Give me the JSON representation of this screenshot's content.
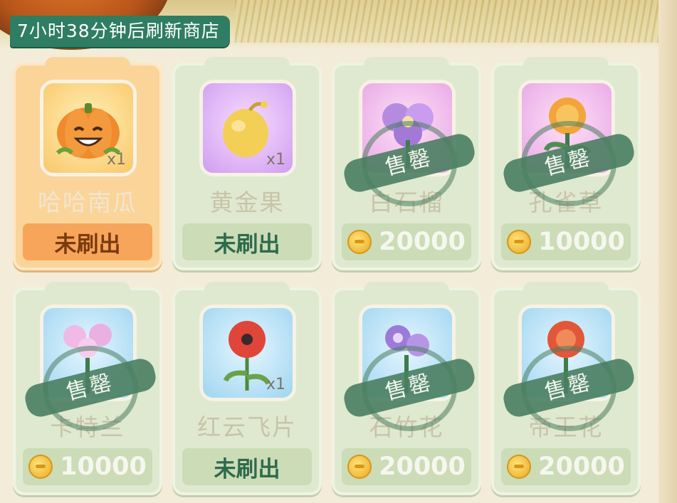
{
  "shop": {
    "refresh_timer": "7小时38分钟后刷新商店",
    "items": [
      {
        "name": "哈哈南瓜",
        "qty": "x1",
        "status": "未刷出",
        "price": "",
        "sold": false,
        "selected": true,
        "icon": "pumpkin-icon",
        "bg": "orange"
      },
      {
        "name": "黄金果",
        "qty": "x1",
        "status": "未刷出",
        "price": "",
        "sold": false,
        "selected": false,
        "icon": "golden-fruit-icon",
        "bg": "purple"
      },
      {
        "name": "白石榴",
        "qty": "",
        "status": "",
        "price": "20000",
        "sold": true,
        "sold_label": "售罄",
        "selected": false,
        "icon": "purple-flower-icon",
        "bg": "pink"
      },
      {
        "name": "孔雀草",
        "qty": "",
        "status": "",
        "price": "10000",
        "sold": true,
        "sold_label": "售罄",
        "selected": false,
        "icon": "marigold-icon",
        "bg": "pink"
      },
      {
        "name": "卡特兰",
        "qty": "",
        "status": "",
        "price": "10000",
        "sold": true,
        "sold_label": "售罄",
        "selected": false,
        "icon": "orchid-icon",
        "bg": "blue"
      },
      {
        "name": "红云飞片",
        "qty": "x1",
        "status": "未刷出",
        "price": "",
        "sold": false,
        "selected": false,
        "icon": "red-poppy-icon",
        "bg": "blue"
      },
      {
        "name": "石竹花",
        "qty": "",
        "status": "",
        "price": "20000",
        "sold": true,
        "sold_label": "售罄",
        "selected": false,
        "icon": "dianthus-icon",
        "bg": "blue"
      },
      {
        "name": "帝王花",
        "qty": "",
        "status": "",
        "price": "20000",
        "sold": true,
        "sold_label": "售罄",
        "selected": false,
        "icon": "protea-icon",
        "bg": "blue"
      }
    ]
  },
  "colors": {
    "accent_green": "#2f7d63",
    "selected_orange": "#f7a55a",
    "card_green": "#dfe9cf",
    "coin_gold": "#e9a924"
  }
}
